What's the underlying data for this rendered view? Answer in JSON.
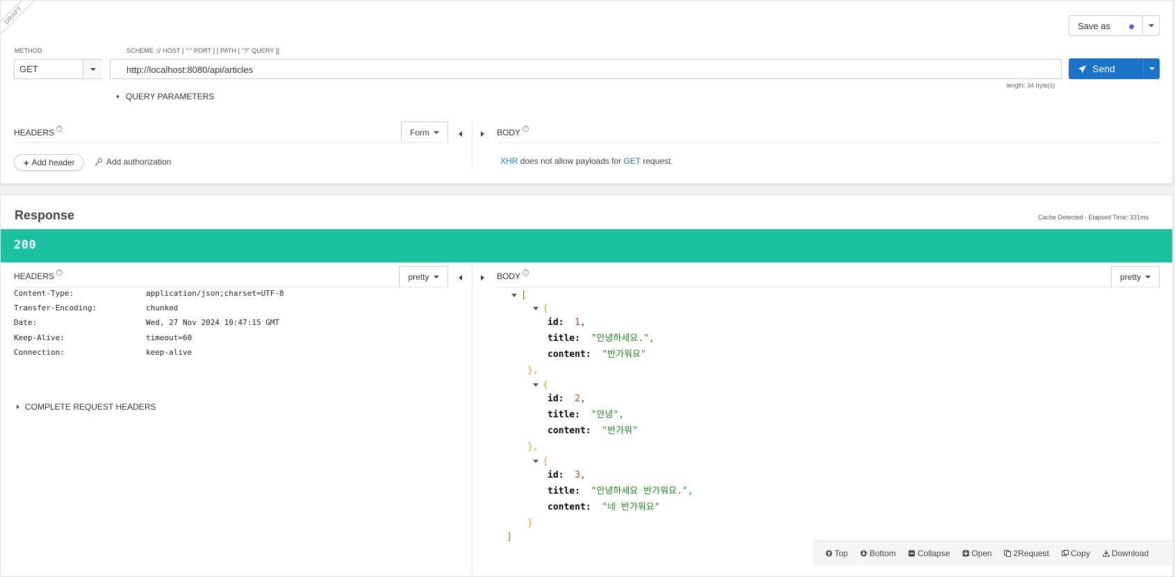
{
  "request": {
    "ribbon": "DRAFT",
    "save_as_label": "Save as",
    "method_label": "METHOD",
    "method_value": "GET",
    "url_label": "SCHEME :// HOST [ \":\" PORT ] [ PATH [ \"?\" QUERY ]]",
    "url_value": "http://localhost:8080/api/articles",
    "url_length": "length: 34 byte(s)",
    "send_label": "Send",
    "query_params_label": "QUERY PARAMETERS",
    "headers_label": "HEADERS",
    "headers_mode": "Form",
    "body_label": "BODY",
    "add_header_label": "Add header",
    "add_authorization_label": "Add authorization",
    "body_message": {
      "xhr": "XHR",
      "middle": " does not allow payloads for ",
      "method": "GET",
      "end": " request."
    }
  },
  "response": {
    "title": "Response",
    "cache_info": "Cache Detected - Elapsed Time: 331ms",
    "status_code": "200",
    "status_color": "#1bc1a1",
    "headers_label": "HEADERS",
    "headers_mode": "pretty",
    "body_label": "BODY",
    "body_mode": "pretty",
    "headers": [
      {
        "key": "Content-Type:",
        "value": "application/json;charset=UTF-8"
      },
      {
        "key": "Transfer-Encoding:",
        "value": "chunked"
      },
      {
        "key": "Date:",
        "value": "Wed, 27 Nov 2024 10:47:15 GMT"
      },
      {
        "key": "Keep-Alive:",
        "value": "timeout=60"
      },
      {
        "key": "Connection:",
        "value": "keep-alive"
      }
    ],
    "complete_headers_label": "COMPLETE REQUEST HEADERS",
    "body_json": [
      {
        "id": "1",
        "title": "\"안녕하세요.\",",
        "content": "\"반가워요\""
      },
      {
        "id": "2",
        "title": "\"안녕\",",
        "content": "\"반가워\""
      },
      {
        "id": "3",
        "title": "\"안녕하세요 반가워요.\",",
        "content": "\"네 반가워요\""
      }
    ],
    "json_labels": {
      "id": "id:",
      "title": "title:",
      "content": "content:",
      "open_bracket": "[",
      "close_bracket": "]",
      "open_brace": "{",
      "close_brace": "},",
      "last_close_brace": "}"
    }
  },
  "toolbar": {
    "top": "Top",
    "bottom": "Bottom",
    "collapse": "Collapse",
    "open": "Open",
    "to_request": "2Request",
    "copy": "Copy",
    "download": "Download"
  },
  "colors": {
    "accent": "#1a7ac6",
    "send_button": "#1a73c9",
    "status_bar": "#1bc1a1",
    "save_dot": "#5b5bc8"
  }
}
